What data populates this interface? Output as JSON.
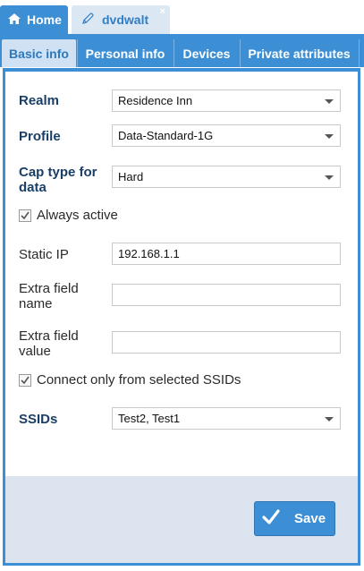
{
  "top_tabs": {
    "home_label": "Home",
    "user_label": "dvdwalt",
    "close_glyph": "×"
  },
  "sub_tabs": [
    {
      "label": "Basic info",
      "active": true
    },
    {
      "label": "Personal info",
      "active": false
    },
    {
      "label": "Devices",
      "active": false
    },
    {
      "label": "Private attributes",
      "active": false
    }
  ],
  "form": {
    "realm": {
      "label": "Realm",
      "value": "Residence Inn"
    },
    "profile": {
      "label": "Profile",
      "value": "Data-Standard-1G"
    },
    "cap_type": {
      "label_line1": "Cap type for",
      "label_line2": "data",
      "value": "Hard"
    },
    "always_active": {
      "label": "Always active",
      "checked": true
    },
    "static_ip": {
      "label": "Static IP",
      "value": "192.168.1.1"
    },
    "extra_field_name": {
      "label_line1": "Extra field",
      "label_line2": "name",
      "value": ""
    },
    "extra_field_value": {
      "label_line1": "Extra field",
      "label_line2": "value",
      "value": ""
    },
    "connect_selected_ssids": {
      "label": "Connect only from selected SSIDs",
      "checked": true
    },
    "ssids": {
      "label": "SSIDs",
      "value": "Test2, Test1"
    }
  },
  "footer": {
    "save_label": "Save"
  },
  "colors": {
    "accent": "#3d8fd5",
    "active_tab": "#cfe1f2",
    "footer_bg": "#dce5ef",
    "label_bold": "#1a3f66"
  },
  "icons": {
    "home": "home-icon",
    "user_tab": "pencil-icon",
    "save": "checkmark-icon"
  }
}
